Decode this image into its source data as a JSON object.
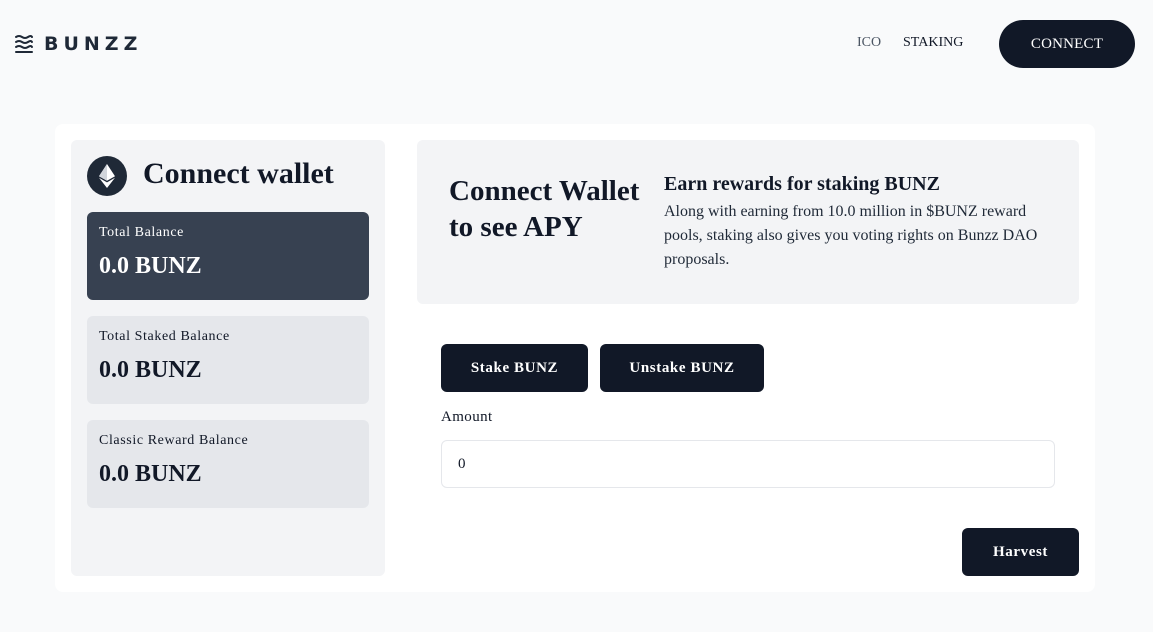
{
  "header": {
    "logo_text": "BUNZZ",
    "nav": [
      {
        "label": "ICO"
      },
      {
        "label": "STAKING"
      }
    ],
    "connect_label": "CONNECT"
  },
  "wallet_panel": {
    "title": "Connect wallet",
    "icon": "ethereum-icon",
    "balances": [
      {
        "label": "Total Balance",
        "value": "0.0 BUNZ"
      },
      {
        "label": "Total Staked Balance",
        "value": "0.0 BUNZ"
      },
      {
        "label": "Classic Reward Balance",
        "value": "0.0 BUNZ"
      }
    ]
  },
  "info": {
    "apy_title": "Connect Wallet to see APY",
    "earn_title": "Earn rewards for staking BUNZ",
    "earn_desc": "Along with earning from 10.0 million in $BUNZ reward pools, staking also gives you voting rights on Bunzz DAO proposals."
  },
  "staking": {
    "stake_label": "Stake BUNZ",
    "unstake_label": "Unstake BUNZ",
    "amount_label": "Amount",
    "amount_value": "0",
    "harvest_label": "Harvest"
  },
  "colors": {
    "primary": "#111827",
    "panel": "#f3f4f6",
    "dark_card": "#374151",
    "light_card": "#e5e7eb",
    "background": "#f9fafb"
  }
}
